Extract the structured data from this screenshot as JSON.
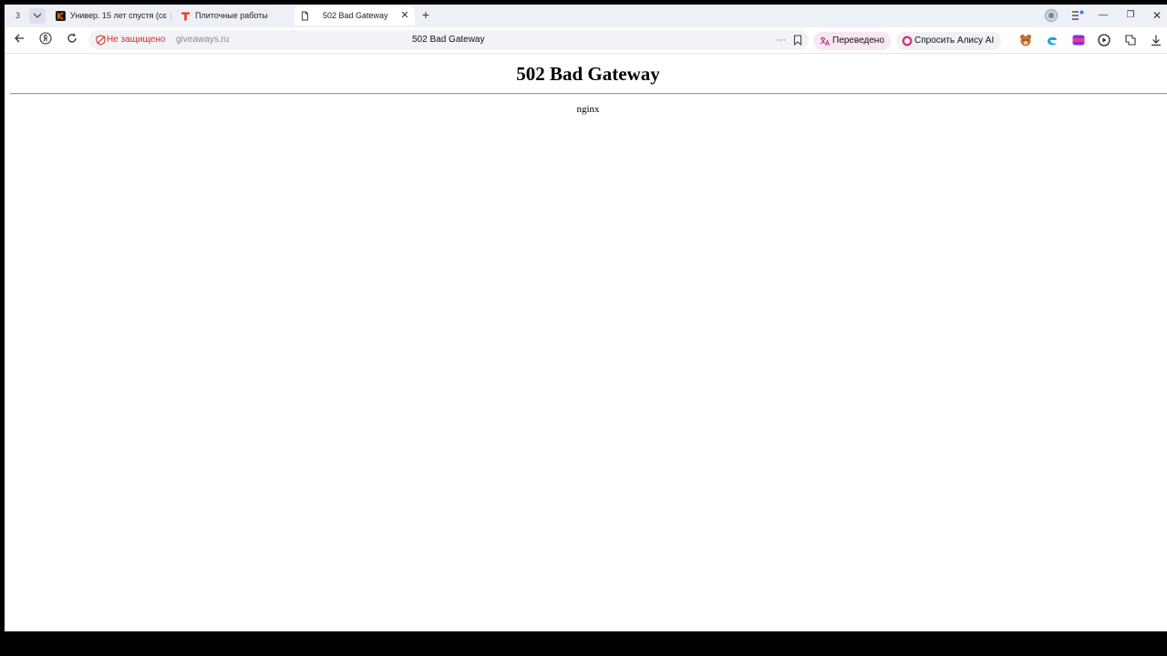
{
  "browser": {
    "tab_count": "3",
    "tabs": [
      {
        "title": "Универ. 15 лет спустя (сє",
        "icon": "kinopoisk-icon"
      },
      {
        "title": "Плиточные работы",
        "icon": "brand-t-icon"
      },
      {
        "title": "502 Bad Gateway",
        "icon": "page-icon",
        "active": true
      }
    ],
    "address_bar": {
      "security_text": "Не защищено",
      "host": "giveaways.ru",
      "page_title": "502 Bad Gateway"
    },
    "translated_label": "Переведено",
    "alice_label": "Спросить Алису AI",
    "colors": {
      "security_red": "#d0302f",
      "alice_pink": "#e0347a",
      "tabbar_bg": "#eef0f8"
    }
  },
  "page": {
    "heading": "502 Bad Gateway",
    "server": "nginx"
  }
}
